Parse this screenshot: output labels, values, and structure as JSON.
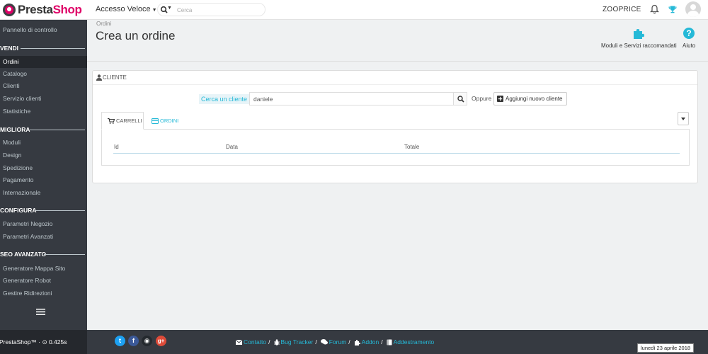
{
  "header": {
    "logo_part1": "Presta",
    "logo_part2": "Shop",
    "quick_access": "Accesso Veloce",
    "search_placeholder": "Cerca",
    "shop_name": "ZOOPRICE"
  },
  "sidebar": {
    "items": [
      {
        "label": "Pannello di controllo",
        "type": "item"
      },
      {
        "label": "VENDI",
        "type": "section"
      },
      {
        "label": "Ordini",
        "type": "item",
        "active": true
      },
      {
        "label": "Catalogo",
        "type": "item"
      },
      {
        "label": "Clienti",
        "type": "item"
      },
      {
        "label": "Servizio clienti",
        "type": "item"
      },
      {
        "label": "Statistiche",
        "type": "item"
      },
      {
        "label": "MIGLIORA",
        "type": "section"
      },
      {
        "label": "Moduli",
        "type": "item"
      },
      {
        "label": "Design",
        "type": "item"
      },
      {
        "label": "Spedizione",
        "type": "item"
      },
      {
        "label": "Pagamento",
        "type": "item"
      },
      {
        "label": "Internazionale",
        "type": "item"
      },
      {
        "label": "CONFIGURA",
        "type": "section"
      },
      {
        "label": "Parametri Negozio",
        "type": "item"
      },
      {
        "label": "Parametri Avanzati",
        "type": "item"
      },
      {
        "label": "SEO AVANZATO",
        "type": "section"
      },
      {
        "label": "Generatore Mappa Sito",
        "type": "item"
      },
      {
        "label": "Generatore Robot",
        "type": "item"
      },
      {
        "label": "Gestire Ridirezioni",
        "type": "item"
      }
    ]
  },
  "page": {
    "breadcrumb": "Ordini",
    "title": "Crea un ordine",
    "toolbar": {
      "modules_label": "Moduli e Servizi raccomandati",
      "help_label": "Aiuto"
    }
  },
  "customer_panel": {
    "heading": "CLIENTE",
    "search_label": "Cerca un cliente",
    "search_value": "daniele",
    "or_label": "Oppure",
    "add_button_label": "Aggiungi nuovo cliente",
    "tabs": [
      {
        "label": "CARRELLI",
        "active": true
      },
      {
        "label": "ORDINI",
        "active": false
      }
    ],
    "table_columns": [
      "Id",
      "Data",
      "Totale"
    ]
  },
  "footer": {
    "version": "PrestaShop™ · ⊙ 0.425s",
    "social": [
      {
        "name": "twitter",
        "glyph": "t",
        "color": "#1da1f2"
      },
      {
        "name": "facebook",
        "glyph": "f",
        "color": "#3b5998"
      },
      {
        "name": "github",
        "glyph": "◉",
        "color": "#24292e"
      },
      {
        "name": "google-plus",
        "glyph": "g+",
        "color": "#dd4b39"
      }
    ],
    "links": [
      {
        "label": "Contatto",
        "icon": "envelope-icon"
      },
      {
        "label": "Bug Tracker",
        "icon": "bug-icon"
      },
      {
        "label": "Forum",
        "icon": "comments-icon"
      },
      {
        "label": "Addon",
        "icon": "puzzle-icon"
      },
      {
        "label": "Addestramento",
        "icon": "book-icon"
      }
    ],
    "date": "lunedì 23 aprile 2018"
  },
  "colors": {
    "brand_pink": "#df0067",
    "accent_blue": "#25b9d7",
    "sidebar_bg": "#363a41",
    "sidebar_active_bg": "#25282d"
  }
}
